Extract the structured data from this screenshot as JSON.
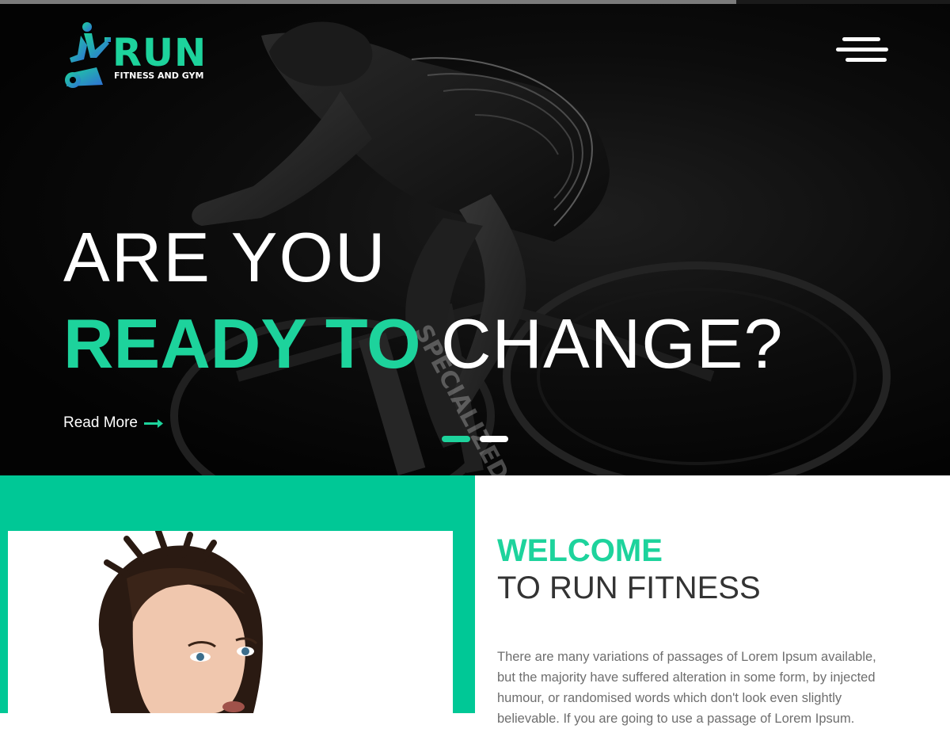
{
  "brand": {
    "name": "RUN",
    "tagline": "FITNESS AND GYM",
    "logo_icon": "exercise-bike-icon",
    "accent_color": "#1dd39c",
    "logo_gradient": [
      "#1dd39c",
      "#2f6fd6"
    ]
  },
  "header": {
    "menu_icon": "hamburger-icon"
  },
  "hero": {
    "headline_line1": "ARE YOU",
    "headline_accent": "READY TO",
    "headline_rest": "CHANGE?",
    "read_more_label": "Read More",
    "read_more_icon": "arrow-right-icon",
    "slides_total": 2,
    "active_slide": 1
  },
  "about": {
    "title_accent": "WELCOME",
    "title_rest": "TO RUN FITNESS",
    "paragraph": "There are many variations of passages of Lorem Ipsum available, but the majority have suffered alteration in some form, by injected humour, or randomised words which don't look even slightly believable. If you are going to use a passage of Lorem Ipsum.",
    "panel_color": "#00c896"
  },
  "scroll_progress": 0.775
}
